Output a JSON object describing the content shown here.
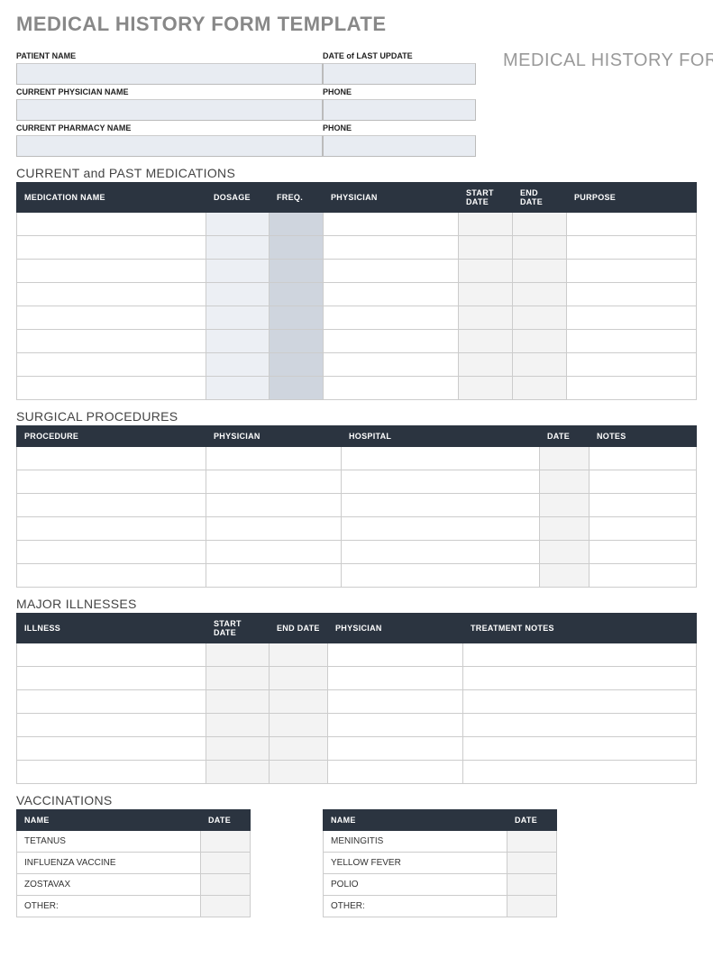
{
  "page_title": "MEDICAL HISTORY FORM TEMPLATE",
  "form_subtitle": "MEDICAL HISTORY FORM",
  "info": {
    "patient_name_label": "PATIENT NAME",
    "last_update_label": "DATE of LAST UPDATE",
    "physician_name_label": "CURRENT PHYSICIAN NAME",
    "physician_phone_label": "PHONE",
    "pharmacy_name_label": "CURRENT PHARMACY NAME",
    "pharmacy_phone_label": "PHONE"
  },
  "sections": {
    "medications": {
      "title": "CURRENT and PAST MEDICATIONS",
      "headers": [
        "MEDICATION NAME",
        "DOSAGE",
        "FREQ.",
        "PHYSICIAN",
        "START DATE",
        "END DATE",
        "PURPOSE"
      ],
      "row_count": 8
    },
    "surgical": {
      "title": "SURGICAL PROCEDURES",
      "headers": [
        "PROCEDURE",
        "PHYSICIAN",
        "HOSPITAL",
        "DATE",
        "NOTES"
      ],
      "row_count": 6
    },
    "illnesses": {
      "title": "MAJOR ILLNESSES",
      "headers": [
        "ILLNESS",
        "START DATE",
        "END DATE",
        "PHYSICIAN",
        "TREATMENT NOTES"
      ],
      "row_count": 6
    },
    "vaccinations": {
      "title": "VACCINATIONS",
      "headers": [
        "NAME",
        "DATE"
      ],
      "left": [
        "TETANUS",
        "INFLUENZA VACCINE",
        "ZOSTAVAX",
        "OTHER:"
      ],
      "right": [
        "MENINGITIS",
        "YELLOW FEVER",
        "POLIO",
        "OTHER:"
      ]
    }
  }
}
